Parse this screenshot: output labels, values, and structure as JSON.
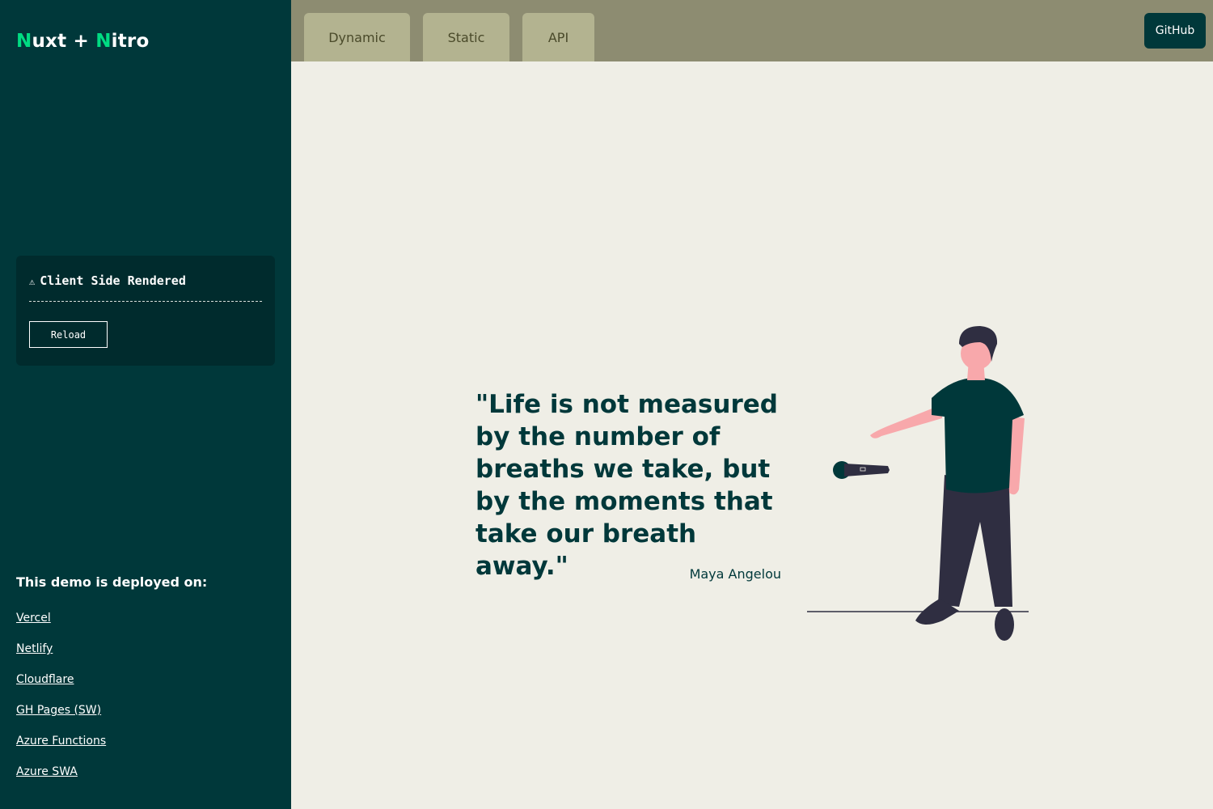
{
  "sidebar": {
    "logo": {
      "part1_initial": "N",
      "part1_rest": "uxt",
      "plus": "+",
      "part2_initial": "N",
      "part2_rest": "itro"
    },
    "csr_panel": {
      "warning_icon": "warning-icon",
      "warning_glyph": "⚠",
      "title": "Client Side Rendered",
      "reload_label": "Reload"
    },
    "deployed_title": "This demo is deployed on:",
    "links": [
      "Vercel",
      "Netlify",
      "Cloudflare",
      "GH Pages (SW)",
      "Azure Functions",
      "Azure SWA"
    ]
  },
  "header": {
    "tabs": [
      "Dynamic",
      "Static",
      "API"
    ],
    "github_label": "GitHub"
  },
  "quote": {
    "text": "\"Life is not measured by the number of breaths we take, but by the moments that take our breath away.\"",
    "author": "Maya Angelou"
  },
  "colors": {
    "sidebar_bg": "#00383a",
    "accent": "#00dc82",
    "header_bg": "#8d8c71",
    "tab_bg": "#b3b390",
    "main_bg": "#efeee6"
  }
}
